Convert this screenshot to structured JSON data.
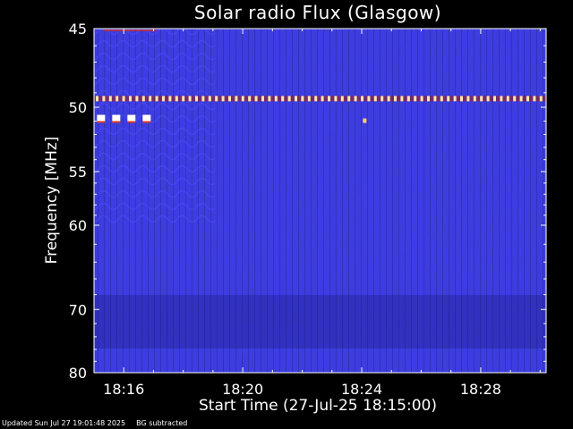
{
  "chart_data": {
    "type": "heatmap",
    "title": "Solar radio Flux (Glasgow)",
    "xlabel": "Start Time (27-Jul-25 18:15:00)",
    "ylabel": "Frequency [MHz]",
    "x_ticks": [
      "18:16",
      "18:20",
      "18:24",
      "18:28"
    ],
    "x_tick_minutes": [
      16,
      20,
      24,
      28
    ],
    "xlim_minutes": [
      15,
      30.2
    ],
    "y_ticks": [
      45,
      50,
      55,
      60,
      70,
      80
    ],
    "ylim": [
      45,
      80
    ],
    "y_scale": "reciprocal",
    "colormap": [
      "#1a1a8c",
      "#2a2ad0",
      "#3c3cff",
      "#8a1a5a",
      "#d23a1a",
      "#ffd28a",
      "#ffffff"
    ],
    "features": [
      {
        "kind": "interference-line",
        "freq_mhz": 49.4,
        "time_start_minutes": 15.0,
        "time_end_minutes": 30.2
      },
      {
        "kind": "burst",
        "freq_mhz": 50.8,
        "time_start_minutes": 15.1,
        "time_end_minutes": 17.1
      },
      {
        "kind": "spot",
        "freq_mhz": 51.0,
        "time_minutes": 24.1
      }
    ]
  },
  "footer": {
    "updated": "Updated Sun Jul 27 19:01:48 2025",
    "note": "BG subtracted"
  },
  "colors": {
    "background": "#000000",
    "axes": "#ffffff",
    "base_signal": "#2c2ccc"
  }
}
